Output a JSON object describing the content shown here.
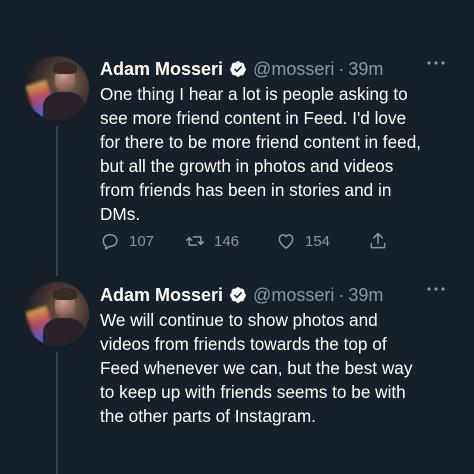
{
  "tweets": [
    {
      "author_name": "Adam Mosseri",
      "handle": "@mosseri",
      "separator": "·",
      "time": "39m",
      "text": "One thing I hear a lot is people asking to see more friend content in Feed. I'd love for there to be more friend content in feed, but all the growth in photos and videos from friends has been in stories and in DMs.",
      "replies": "107",
      "retweets": "146",
      "likes": "154"
    },
    {
      "author_name": "Adam Mosseri",
      "handle": "@mosseri",
      "separator": "·",
      "time": "39m",
      "text": "We will continue to show photos and videos from friends towards the top of Feed whenever we can, but the best way to keep up with friends seems to be with the other parts of Instagram."
    }
  ],
  "icons": {
    "verified": "verified-badge-icon",
    "more": "more-dots-icon",
    "reply": "reply-icon",
    "retweet": "retweet-icon",
    "like": "heart-icon",
    "share": "share-icon"
  },
  "colors": {
    "background": "#15202b",
    "primary_text": "#ffffff",
    "secondary_text": "#8899a6",
    "thread_line": "#38444d",
    "verified_badge": "#ffffff"
  }
}
